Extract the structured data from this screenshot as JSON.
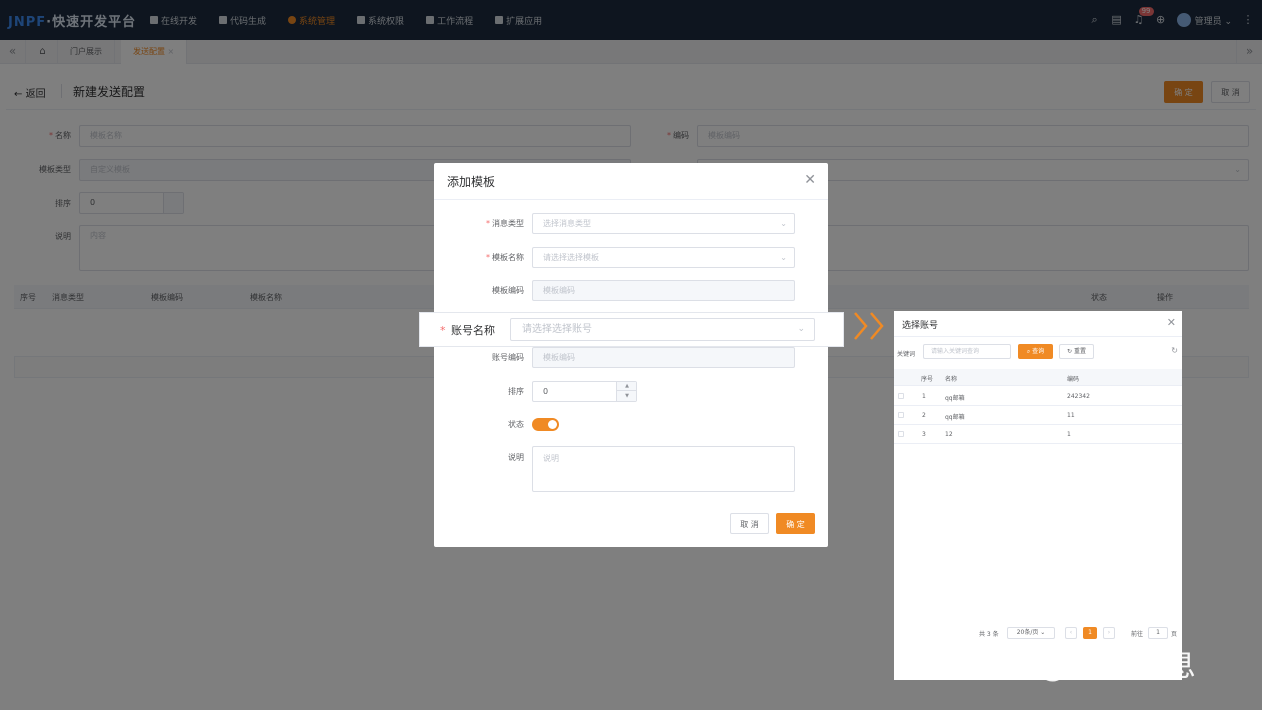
{
  "app": {
    "logo_brand": "JNPF",
    "logo_text": "·快速开发平台",
    "nav": [
      "在线开发",
      "代码生成",
      "系统管理",
      "系统权限",
      "工作流程",
      "扩展应用"
    ],
    "active_nav": "系统管理",
    "notification_count": "99",
    "username": "管理员"
  },
  "tabs": {
    "items": [
      "门户展示",
      "发送配置"
    ],
    "active": "发送配置"
  },
  "page": {
    "back_label": "返回",
    "title": "新建发送配置",
    "confirm_label": "确 定",
    "cancel_label": "取 消"
  },
  "form": {
    "name_label": "名称",
    "name_placeholder": "模板名称",
    "code_label": "编码",
    "code_placeholder": "模板编码",
    "template_type_label": "模板类型",
    "template_type_value": "自定义模板",
    "sort_label": "排序",
    "sort_value": "0",
    "desc_label": "说明",
    "desc_placeholder": "内容"
  },
  "table": {
    "headers": [
      "序号",
      "消息类型",
      "模板编码",
      "模板名称",
      "状态",
      "操作"
    ]
  },
  "dialog": {
    "title": "添加模板",
    "msg_type_label": "消息类型",
    "msg_type_placeholder": "选择消息类型",
    "tpl_name_label": "模板名称",
    "tpl_name_placeholder": "请选择选择模板",
    "tpl_code_label": "模板编码",
    "tpl_code_placeholder": "模板编码",
    "account_name_label": "账号名称",
    "account_name_placeholder": "请选择选择账号",
    "account_code_label": "账号编码",
    "account_code_placeholder": "模板编码",
    "sort_label": "排序",
    "sort_value": "0",
    "status_label": "状态",
    "status_on": true,
    "desc_label": "说明",
    "desc_placeholder": "说明",
    "cancel_label": "取 消",
    "confirm_label": "确 定"
  },
  "account_panel": {
    "title": "选择账号",
    "keyword_label": "关键词",
    "keyword_placeholder": "请输入关键词查询",
    "search_label": "查询",
    "reset_label": "重置",
    "headers": [
      "序号",
      "名称",
      "编码"
    ],
    "rows": [
      {
        "index": "1",
        "name": "qq邮箱",
        "code": "242342"
      },
      {
        "index": "2",
        "name": "qq邮箱",
        "code": "11"
      },
      {
        "index": "3",
        "name": "12",
        "code": "1"
      }
    ],
    "total_text": "共 3 条",
    "page_size": "20条/页",
    "current_page": "1",
    "goto_label": "前往",
    "goto_value": "1",
    "page_unit": "页"
  },
  "watermark": "知乎 @引迈信息",
  "colors": {
    "accent": "#f08a24",
    "topbar": "#1c2b3e",
    "required": "#f56c6c"
  }
}
